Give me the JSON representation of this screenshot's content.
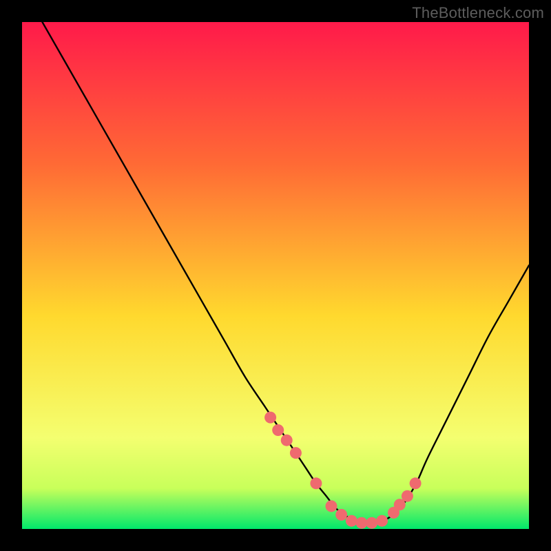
{
  "watermark": "TheBottleneck.com",
  "colors": {
    "frame": "#000000",
    "gradient_top": "#ff1a4a",
    "gradient_mid_upper": "#ff7a2e",
    "gradient_mid": "#ffd92e",
    "gradient_lower": "#f7ff6a",
    "gradient_bottom": "#00e86b",
    "curve": "#000000",
    "marker": "#ef6a6f",
    "watermark": "#5d5d5d"
  },
  "chart_data": {
    "type": "line",
    "title": "",
    "xlabel": "",
    "ylabel": "",
    "xlim": [
      0,
      100
    ],
    "ylim": [
      0,
      100
    ],
    "series": [
      {
        "name": "bottleneck-curve",
        "x": [
          4,
          8,
          12,
          16,
          20,
          24,
          28,
          32,
          36,
          40,
          44,
          48,
          52,
          54,
          56,
          58,
          60,
          62,
          64,
          66,
          68,
          70,
          72,
          74,
          76,
          78,
          80,
          84,
          88,
          92,
          96,
          100
        ],
        "y": [
          100,
          93,
          86,
          79,
          72,
          65,
          58,
          51,
          44,
          37,
          30,
          24,
          18,
          15,
          12,
          9,
          6.5,
          4,
          2.5,
          1.5,
          1,
          1.2,
          2,
          3.5,
          6,
          9.5,
          14,
          22,
          30,
          38,
          45,
          52
        ]
      }
    ],
    "markers": {
      "name": "highlighted-points",
      "x": [
        49,
        50.5,
        52.2,
        54,
        58,
        61,
        63,
        65,
        67,
        69,
        71,
        73.3,
        74.5,
        76,
        77.6
      ],
      "y": [
        22,
        19.5,
        17.5,
        15,
        9,
        4.5,
        2.8,
        1.6,
        1.2,
        1.2,
        1.6,
        3.2,
        4.8,
        6.5,
        9
      ]
    },
    "annotations": []
  }
}
